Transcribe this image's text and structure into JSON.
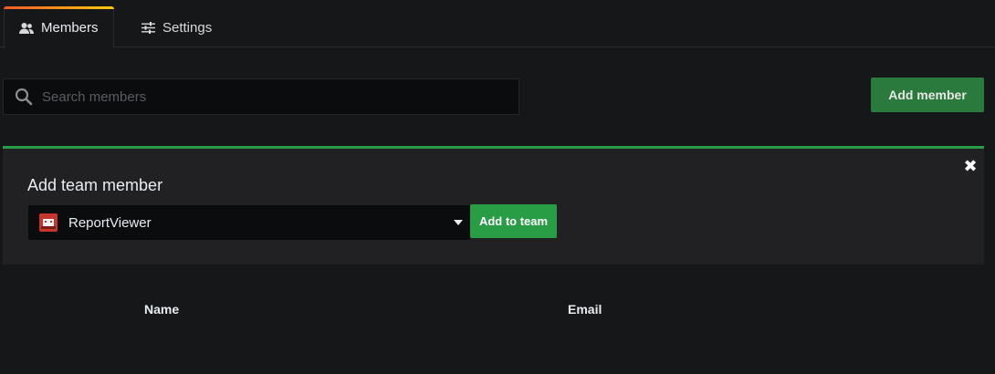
{
  "tabs": [
    {
      "label": "Members",
      "icon": "users-icon",
      "active": true
    },
    {
      "label": "Settings",
      "icon": "sliders-icon",
      "active": false
    }
  ],
  "search": {
    "placeholder": "Search members",
    "value": ""
  },
  "toolbar": {
    "add_member_label": "Add member"
  },
  "add_member_panel": {
    "title": "Add team member",
    "selected_user": "ReportViewer",
    "add_button_label": "Add to team",
    "close_icon": "close-icon"
  },
  "table": {
    "columns": [
      "Name",
      "Email"
    ]
  },
  "colors": {
    "background": "#161719",
    "accent_green": "#299c46",
    "tab_gradient_start": "#f05a28",
    "tab_gradient_end": "#fbca0a",
    "panel": "#212124"
  }
}
